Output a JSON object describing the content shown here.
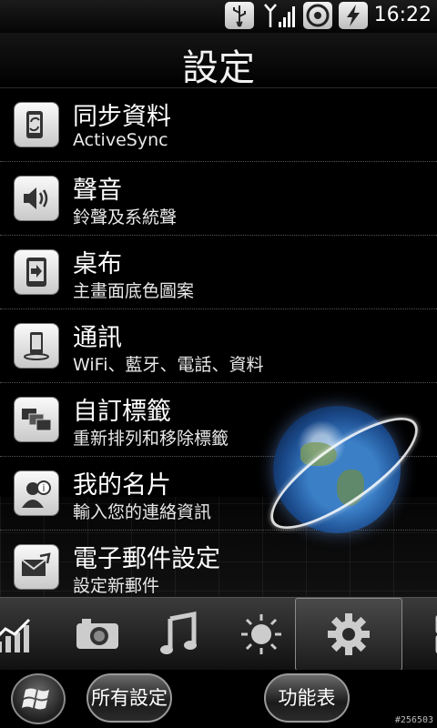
{
  "status_bar": {
    "time": "16:22",
    "icons": [
      "usb-icon",
      "signal-icon",
      "disc-icon",
      "battery-charging-icon"
    ]
  },
  "header": {
    "title": "設定"
  },
  "settings": [
    {
      "title": "同步資料",
      "subtitle": "ActiveSync",
      "icon": "sync-icon"
    },
    {
      "title": "聲音",
      "subtitle": "鈴聲及系統聲",
      "icon": "speaker-icon"
    },
    {
      "title": "桌布",
      "subtitle": "主畫面底色圖案",
      "icon": "wallpaper-icon"
    },
    {
      "title": "通訊",
      "subtitle": "WiFi、藍牙、電話、資料",
      "icon": "phone-icon"
    },
    {
      "title": "自訂標籤",
      "subtitle": "重新排列和移除標籤",
      "icon": "tabs-icon"
    },
    {
      "title": "我的名片",
      "subtitle": "輸入您的連絡資訊",
      "icon": "contact-card-icon"
    },
    {
      "title": "電子郵件設定",
      "subtitle": "設定新郵件",
      "icon": "email-icon"
    }
  ],
  "tabs": [
    {
      "icon": "stocks-icon"
    },
    {
      "icon": "camera-icon"
    },
    {
      "icon": "music-icon"
    },
    {
      "icon": "weather-icon"
    },
    {
      "icon": "settings-gear-icon",
      "selected": true
    },
    {
      "icon": "grid-icon"
    }
  ],
  "bottom_bar": {
    "all_settings_label": "所有設定",
    "menu_label": "功能表"
  },
  "watermark": "#256503"
}
